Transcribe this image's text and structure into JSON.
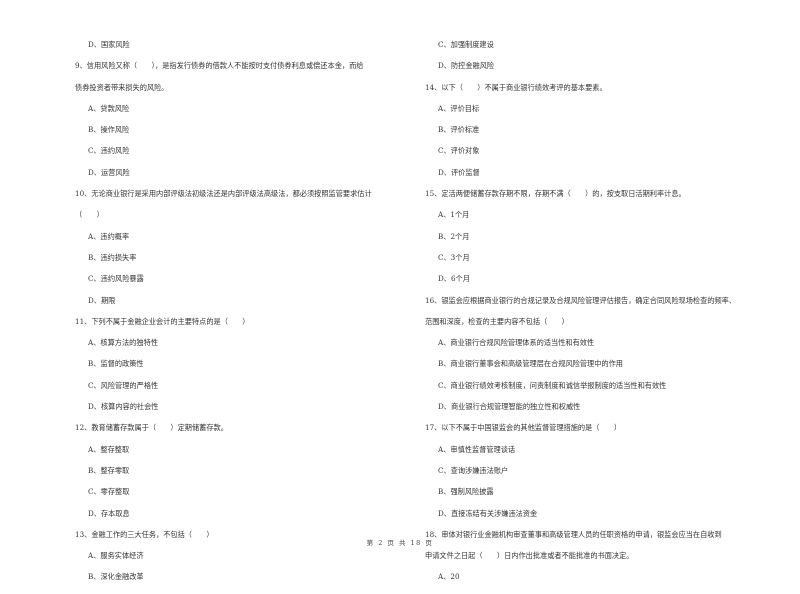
{
  "left_column": [
    {
      "type": "opt",
      "text": "D、国家风险"
    },
    {
      "type": "q",
      "text": "9、信用风险又称（　　），是指发行债券的借款人不能按时支付债券利息或偿还本金，而给"
    },
    {
      "type": "q-cont",
      "text": "债券投资者带来损失的风险。"
    },
    {
      "type": "opt",
      "text": "A、贷款风险"
    },
    {
      "type": "opt",
      "text": "B、操作风险"
    },
    {
      "type": "opt",
      "text": "C、违约风险"
    },
    {
      "type": "opt",
      "text": "D、运营风险"
    },
    {
      "type": "q",
      "text": "10、无论商业银行是采用内部评级法初级法还是内部评级法高级法，都必须按照监管要求估计"
    },
    {
      "type": "q-cont",
      "text": "（　　）"
    },
    {
      "type": "opt",
      "text": "A、违约概率"
    },
    {
      "type": "opt",
      "text": "B、违约损失率"
    },
    {
      "type": "opt",
      "text": "C、违约风险暴露"
    },
    {
      "type": "opt",
      "text": "D、期限"
    },
    {
      "type": "q",
      "text": "11、下列不属于金融企业会计的主要特点的是（　　）"
    },
    {
      "type": "opt",
      "text": "A、核算方法的独特性"
    },
    {
      "type": "opt",
      "text": "B、监督的政策性"
    },
    {
      "type": "opt",
      "text": "C、风险管理的严格性"
    },
    {
      "type": "opt",
      "text": "D、核算内容的社会性"
    },
    {
      "type": "q",
      "text": "12、教育储蓄存款属于（　　）定期储蓄存款。"
    },
    {
      "type": "opt",
      "text": "A、整存整取"
    },
    {
      "type": "opt",
      "text": "B、整存零取"
    },
    {
      "type": "opt",
      "text": "C、零存整取"
    },
    {
      "type": "opt",
      "text": "D、存本取息"
    },
    {
      "type": "q",
      "text": "13、金融工作的三大任务，不包括（　　）"
    },
    {
      "type": "opt",
      "text": "A、服务实体经济"
    },
    {
      "type": "opt",
      "text": "B、深化金融改革"
    }
  ],
  "right_column": [
    {
      "type": "opt",
      "text": "C、加强制度建设"
    },
    {
      "type": "opt",
      "text": "D、防控金融风险"
    },
    {
      "type": "q",
      "text": "14、以下（　　）不属于商业银行绩效考评的基本要素。"
    },
    {
      "type": "opt",
      "text": "A、评价目标"
    },
    {
      "type": "opt",
      "text": "B、评价标准"
    },
    {
      "type": "opt",
      "text": "C、评价对象"
    },
    {
      "type": "opt",
      "text": "D、评价监督"
    },
    {
      "type": "q",
      "text": "15、定活两便储蓄存款存期不限，存期不满（　　）的，按支取日活期利率计息。"
    },
    {
      "type": "opt",
      "text": "A、1个月"
    },
    {
      "type": "opt",
      "text": "B、2个月"
    },
    {
      "type": "opt",
      "text": "C、3个月"
    },
    {
      "type": "opt",
      "text": "D、6个月"
    },
    {
      "type": "q",
      "text": "16、银监会应根据商业银行的合规记录及合规风险管理评估报告，确定合同风险现场检查的频率、"
    },
    {
      "type": "q-cont",
      "text": "范围和深度，检查的主要内容不包括（　　）"
    },
    {
      "type": "opt",
      "text": "A、商业银行合规风险管理体系的适当性和有效性"
    },
    {
      "type": "opt",
      "text": "B、商业银行董事会和高级管理层在合规风险管理中的作用"
    },
    {
      "type": "opt",
      "text": "C、商业银行绩效考核制度，问责制度和诚信举报制度的适当性和有效性"
    },
    {
      "type": "opt",
      "text": "D、商业银行合规管理智能的独立性和权威性"
    },
    {
      "type": "q",
      "text": "17、以下不属于中国银监会的其他监督管理措施的是（　　）"
    },
    {
      "type": "opt",
      "text": "A、审慎性监督管理谈话"
    },
    {
      "type": "opt",
      "text": "C、查询涉嫌违法账户"
    },
    {
      "type": "opt",
      "text": "B、强制风险披露"
    },
    {
      "type": "opt",
      "text": "D、直接冻结有关涉嫌违法资金"
    },
    {
      "type": "q",
      "text": "18、审体对银行业金融机构审查董事和高级管理人员的任职资格的申请，银监会应当在自收到"
    },
    {
      "type": "q-cont",
      "text": "申请文件之日起（　　）日内作出批准或者不能批准的书面决定。"
    },
    {
      "type": "opt",
      "text": "A、20"
    }
  ],
  "footer": {
    "page_label": "第 2 页 共 18 页"
  }
}
